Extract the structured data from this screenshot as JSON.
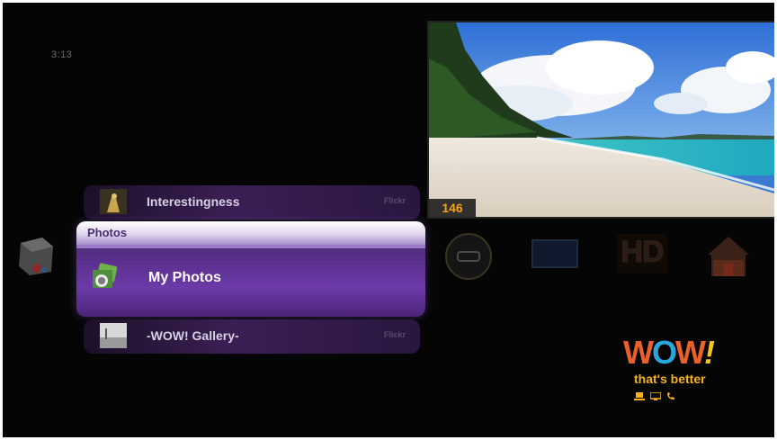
{
  "status": {
    "clock": "3:13"
  },
  "preview": {
    "channel_number": "146"
  },
  "menu": {
    "top_item": {
      "label": "Interestingness",
      "more": "Flickr"
    },
    "active_item": {
      "category": "Photos",
      "label": "My Photos"
    },
    "bottom_item": {
      "label": "-WOW! Gallery-",
      "more": "Flickr"
    }
  },
  "side_icons": [
    "cube-icon",
    "circle-remote-icon",
    "screen-icon",
    "hd-icon",
    "home-icon"
  ],
  "hd_label": "HD",
  "brand": {
    "logo_parts": [
      "W",
      "O",
      "W",
      "!"
    ],
    "tagline": "that's better",
    "device_icons": [
      "laptop-icon",
      "tv-icon",
      "phone-icon"
    ],
    "colors": {
      "w": "#e8602a",
      "o": "#2aa6dc",
      "exclaim": "#f6c220",
      "tagline": "#f6b21a"
    }
  }
}
